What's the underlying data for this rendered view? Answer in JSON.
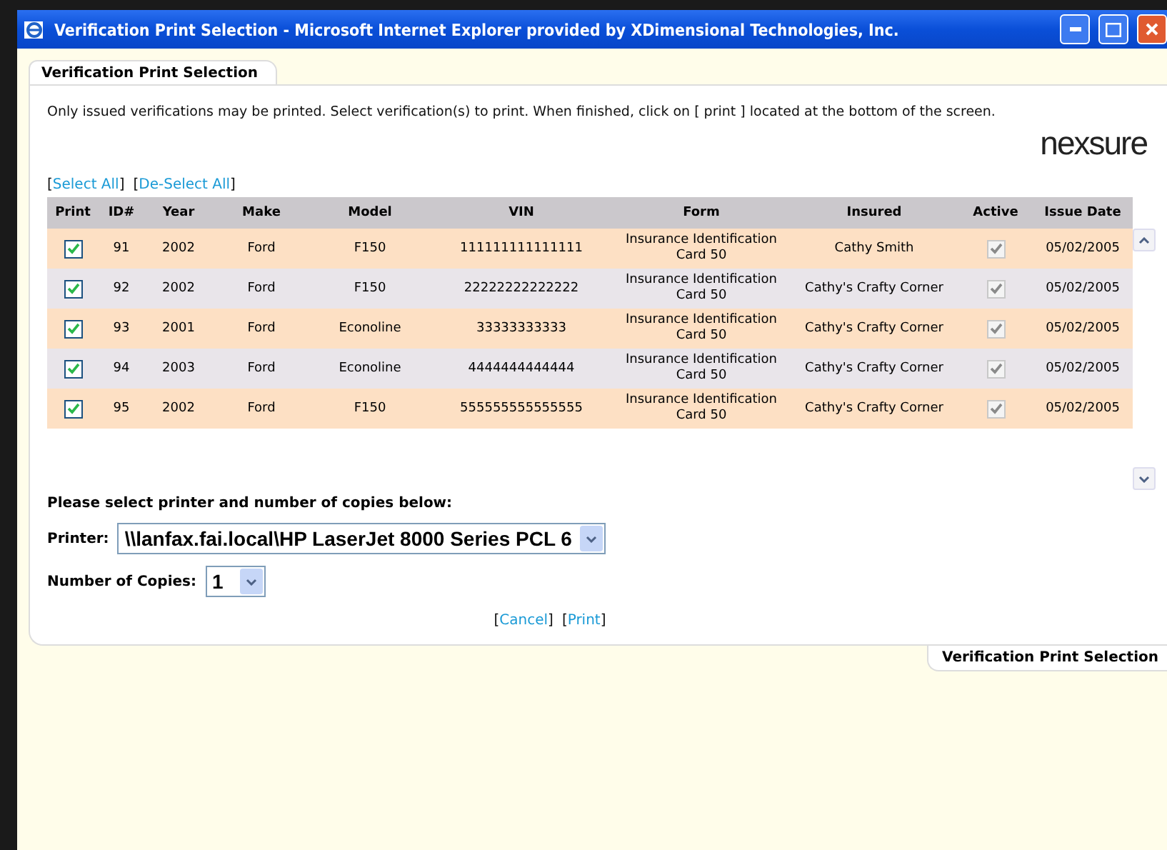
{
  "window": {
    "title": "Verification Print Selection - Microsoft Internet Explorer provided by XDimensional Technologies, Inc."
  },
  "tab": {
    "label": "Verification Print Selection"
  },
  "instructions": "Only issued verifications may be printed. Select verification(s) to print. When finished, click on [ print ] located at the bottom of the screen.",
  "logo": "nexsure",
  "bulk_links": [
    {
      "open": "[",
      "label": "Select All",
      "close": "]"
    },
    {
      "open": "[",
      "label": "De-Select All",
      "close": "]"
    }
  ],
  "table": {
    "columns": [
      "Print",
      "ID#",
      "Year",
      "Make",
      "Model",
      "VIN",
      "Form",
      "Insured",
      "Active",
      "Issue Date"
    ],
    "rows": [
      {
        "print": true,
        "id": "91",
        "year": "2002",
        "make": "Ford",
        "model": "F150",
        "vin": "111111111111111",
        "form": "Insurance Identification Card 50",
        "insured": "Cathy Smith",
        "active": true,
        "issue_date": "05/02/2005"
      },
      {
        "print": true,
        "id": "92",
        "year": "2002",
        "make": "Ford",
        "model": "F150",
        "vin": "22222222222222",
        "form": "Insurance Identification Card 50",
        "insured": "Cathy's Crafty Corner",
        "active": true,
        "issue_date": "05/02/2005"
      },
      {
        "print": true,
        "id": "93",
        "year": "2001",
        "make": "Ford",
        "model": "Econoline",
        "vin": "33333333333",
        "form": "Insurance Identification Card 50",
        "insured": "Cathy's Crafty Corner",
        "active": true,
        "issue_date": "05/02/2005"
      },
      {
        "print": true,
        "id": "94",
        "year": "2003",
        "make": "Ford",
        "model": "Econoline",
        "vin": "4444444444444",
        "form": "Insurance Identification Card 50",
        "insured": "Cathy's Crafty Corner",
        "active": true,
        "issue_date": "05/02/2005"
      },
      {
        "print": true,
        "id": "95",
        "year": "2002",
        "make": "Ford",
        "model": "F150",
        "vin": "555555555555555",
        "form": "Insurance Identification Card 50",
        "insured": "Cathy's Crafty Corner",
        "active": true,
        "issue_date": "05/02/2005"
      }
    ]
  },
  "printer_section": {
    "heading": "Please select printer and number of copies below:",
    "printer_label": "Printer:",
    "printer_value": "\\\\lanfax.fai.local\\HP LaserJet 8000 Series PCL 6",
    "copies_label": "Number of Copies:",
    "copies_value": "1"
  },
  "actions": [
    {
      "open": "[",
      "label": "Cancel",
      "close": "]"
    },
    {
      "open": "[",
      "label": "Print",
      "close": "]"
    }
  ],
  "footer_tab": "Verification Print Selection"
}
